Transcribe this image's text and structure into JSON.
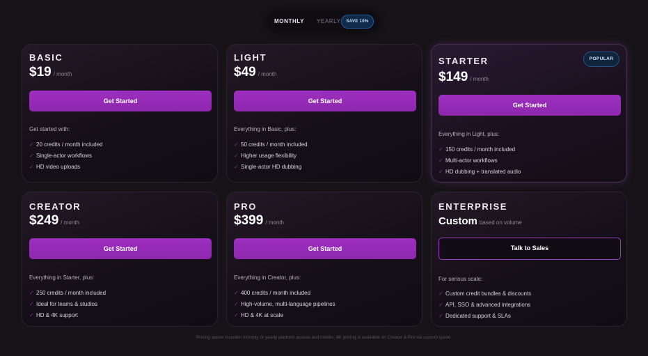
{
  "billing_toggle": {
    "monthly_label": "MONTHLY",
    "yearly_label": "YEARLY",
    "save_badge": "SAVE 10%",
    "selected": "MONTHLY"
  },
  "plans": [
    {
      "tier": "BASIC",
      "price": "$19",
      "period": "/ month",
      "cta": "Get Started",
      "intro": "Get started with:",
      "features": [
        "20 credits / month included",
        "Single-actor workflows",
        "HD video uploads"
      ]
    },
    {
      "tier": "LIGHT",
      "price": "$49",
      "period": "/ month",
      "cta": "Get Started",
      "intro": "Everything in Basic, plus:",
      "features": [
        "50 credits / month included",
        "Higher usage flexibility",
        "Single-actor HD dubbing"
      ]
    },
    {
      "tier": "STARTER",
      "badge": "POPULAR",
      "price": "$149",
      "period": "/ month",
      "cta": "Get Started",
      "intro": "Everything in Light, plus:",
      "features": [
        "150 credits / month included",
        "Multi-actor workflows",
        "HD dubbing + translated audio"
      ]
    },
    {
      "tier": "CREATOR",
      "price": "$249",
      "period": "/ month",
      "cta": "Get Started",
      "intro": "Everything in Starter, plus:",
      "features": [
        "250 credits / month included",
        "Ideal for teams & studios",
        "HD & 4K support"
      ]
    },
    {
      "tier": "PRO",
      "price": "$399",
      "period": "/ month",
      "cta": "Get Started",
      "intro": "Everything in Creator, plus:",
      "features": [
        "400 credits / month included",
        "High-volume, multi-language pipelines",
        "HD & 4K at scale"
      ]
    },
    {
      "tier": "ENTERPRISE",
      "price": "Custom",
      "period": "based on volume",
      "cta": "Talk to Sales",
      "intro": "For serious scale:",
      "features": [
        "Custom credit bundles & discounts",
        "API, SSO & advanced integrations",
        "Dedicated support & SLAs"
      ]
    }
  ],
  "check_icon": "✓",
  "footer_note": "Pricing above includes monthly or yearly platform access and credits. 4K pricing is available on Creator & Pro via custom quote.",
  "colors": {
    "accent_purple": "#9d2fbf",
    "badge_blue": "#10243c",
    "background": "#161417"
  }
}
